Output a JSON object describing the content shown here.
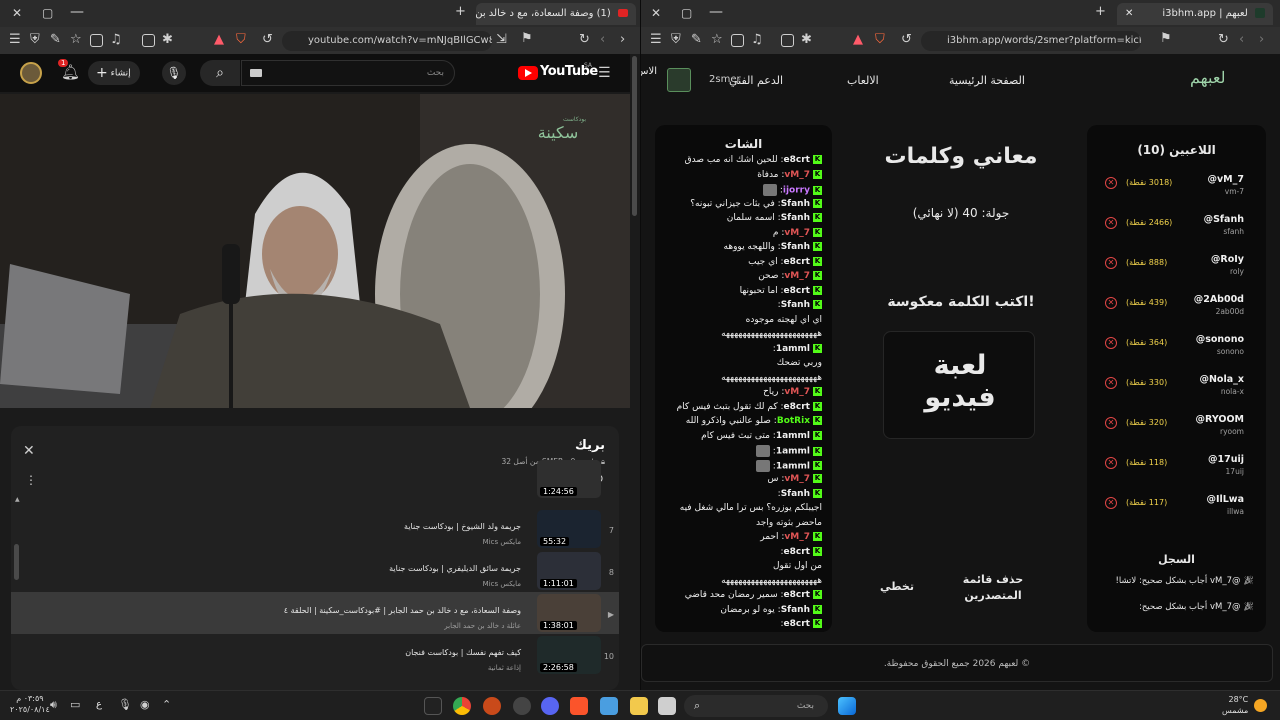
{
  "left_window": {
    "tab_title": "(1) وصفة السعادة، مع د خالد بن ح...",
    "url": "youtube.com/watch?v=mNJqBIlGCw8&list=...",
    "youtube": {
      "logo": "YouTube",
      "country": "SA",
      "search_placeholder": "بحث",
      "create_label": "إنشاء",
      "notification_count": "1",
      "watermark_small": "بودكاست",
      "watermark_big": "سكينة"
    },
    "playlist": {
      "title": "بريك",
      "meta": "خاص · SMER - 9 من أصل 32",
      "rows": [
        {
          "num": "",
          "title": "",
          "channel": "",
          "duration": "1:24:56"
        },
        {
          "num": "7",
          "title": "جريمة ولد الشيوخ | بودكاست جناية",
          "channel": "Mics مايكس",
          "duration": "55:32"
        },
        {
          "num": "8",
          "title": "جريمة سائق الديليفري | بودكاست جناية",
          "channel": "Mics مايكس",
          "duration": "1:11:01"
        },
        {
          "num": "▶",
          "title": "وصفة السعادة، مع د خالد بن حمد الجابر | #بودكاست_سكينة | الحلقة ٤",
          "channel": "عائلة د خالد بن حمد الجابر",
          "duration": "1:38:01"
        },
        {
          "num": "10",
          "title": "كيف تفهم نفسك | بودكاست فنجان",
          "channel": "إذاعة ثمانية",
          "duration": "2:26:58"
        }
      ]
    }
  },
  "right_window": {
    "tab_title": "لعبهم | i3bhm.app",
    "url": "i3bhm.app/words/2smer?platform=kick",
    "nav": {
      "logo": "لعبهم",
      "home": "الصفحة الرئيسية",
      "games": "الالعاب",
      "support": "الدعم الفني",
      "username": "2smer",
      "cut": "الاس"
    },
    "players": {
      "title": "اللاعبين (10)",
      "list": [
        {
          "name": "@vM_7",
          "id": "vm-7",
          "points": "(3018 نقطة)"
        },
        {
          "name": "@Sfanh",
          "id": "sfanh",
          "points": "(2466 نقطة)"
        },
        {
          "name": "@RoIy",
          "id": "roly",
          "points": "(888 نقطة)"
        },
        {
          "name": "@2Ab00d",
          "id": "2ab00d",
          "points": "(439 نقطة)"
        },
        {
          "name": "@sonono",
          "id": "sonono",
          "points": "(364 نقطة)"
        },
        {
          "name": "@Nola_x",
          "id": "nola-x",
          "points": "(330 نقطة)"
        },
        {
          "name": "@RYOOM",
          "id": "ryoom",
          "points": "(320 نقطة)"
        },
        {
          "name": "@17uij",
          "id": "17uij",
          "points": "(118 نقطة)"
        },
        {
          "name": "@IlLwa",
          "id": "illwa",
          "points": "(117 نقطة)"
        }
      ]
    },
    "log": {
      "title": "السجل",
      "entries": [
        "@vM_7 أجاب بشكل صحيح: لاتشا!",
        "@vM_7 أجاب بشكل صحيح:"
      ]
    },
    "game": {
      "title": "معاني وكلمات",
      "round": "جولة: 40 (لا نهائي)",
      "instruction": "اكتب الكلمة معكوسة!",
      "word": "لعبة فيديو",
      "delete_leaderboard": "حذف قائمة المتصدرين",
      "skip": "تخطي"
    },
    "chat": {
      "title": "الشات",
      "lines": [
        {
          "user": "e8crt",
          "color": "#f0f0f0",
          "msg": "للحين اشك انه مب صدق"
        },
        {
          "user": "vM_7",
          "color": "#e05555",
          "msg": "مدفأة"
        },
        {
          "user": "ijorry",
          "color": "#c978ff",
          "msg": "🖼"
        },
        {
          "user": "Sfanh",
          "color": "#f0f0f0",
          "msg": "في بثات جيزاني تبونه؟"
        },
        {
          "user": "Sfanh",
          "color": "#f0f0f0",
          "msg": "اسمه سلمان"
        },
        {
          "user": "vM_7",
          "color": "#e05555",
          "msg": "م"
        },
        {
          "user": "Sfanh",
          "color": "#f0f0f0",
          "msg": "واللهجه يووهه"
        },
        {
          "user": "e8crt",
          "color": "#f0f0f0",
          "msg": "اي جيب"
        },
        {
          "user": "vM_7",
          "color": "#e05555",
          "msg": "صحن"
        },
        {
          "user": "e8crt",
          "color": "#f0f0f0",
          "msg": "اما تحبونها"
        },
        {
          "user": "Sfanh",
          "color": "#f0f0f0",
          "msg": ""
        },
        {
          "user": "",
          "color": "#f0f0f0",
          "msg": "اي اي لهجته موجوده"
        },
        {
          "user": "",
          "color": "#f0f0f0",
          "msg": "هههههههههههههههههههههههه"
        },
        {
          "user": "1amml",
          "color": "#f0f0f0",
          "msg": ""
        },
        {
          "user": "",
          "color": "#f0f0f0",
          "msg": "وربي تضحك"
        },
        {
          "user": "",
          "color": "#f0f0f0",
          "msg": "هههههههههههههههههههههههه"
        },
        {
          "user": "vM_7",
          "color": "#e05555",
          "msg": "رياح"
        },
        {
          "user": "e8crt",
          "color": "#f0f0f0",
          "msg": "كم لك تقول بتبث فيس كام"
        },
        {
          "user": "BotRix",
          "color": "#53fc18",
          "msg": "صلو عالنبي واذكرو الله"
        },
        {
          "user": "1amml",
          "color": "#f0f0f0",
          "msg": "متى تبث فيس كام"
        },
        {
          "user": "1amml",
          "color": "#f0f0f0",
          "msg": "🖼"
        },
        {
          "user": "1amml",
          "color": "#f0f0f0",
          "msg": "🖼"
        },
        {
          "user": "vM_7",
          "color": "#e05555",
          "msg": "س"
        },
        {
          "user": "Sfanh",
          "color": "#f0f0f0",
          "msg": ""
        },
        {
          "user": "",
          "color": "#f0f0f0",
          "msg": "اجيبلكم يوزره؟ بس ترا مالي شغل فيه"
        },
        {
          "user": "",
          "color": "#f0f0f0",
          "msg": "ماحضر بثوته واجد"
        },
        {
          "user": "vM_7",
          "color": "#e05555",
          "msg": "أحمر"
        },
        {
          "user": "e8crt",
          "color": "#f0f0f0",
          "msg": ""
        },
        {
          "user": "",
          "color": "#f0f0f0",
          "msg": "من اول تقول"
        },
        {
          "user": "",
          "color": "#f0f0f0",
          "msg": "هههههههههههههههههههههههه"
        },
        {
          "user": "e8crt",
          "color": "#f0f0f0",
          "msg": "سمير رمضان محد قاضي"
        },
        {
          "user": "Sfanh",
          "color": "#f0f0f0",
          "msg": "يوه لو برمضان"
        },
        {
          "user": "e8crt",
          "color": "#f0f0f0",
          "msg": ""
        }
      ]
    },
    "footer": "© لعبهم 2026 جميع الحقوق محفوظة."
  },
  "taskbar": {
    "time": "٠٣:٥٩ م",
    "date": "٢٠٢٥/٠٨/١٤",
    "search_placeholder": "بحث",
    "weather_temp": "28°C",
    "weather_desc": "مشمس",
    "lang": "ع"
  }
}
